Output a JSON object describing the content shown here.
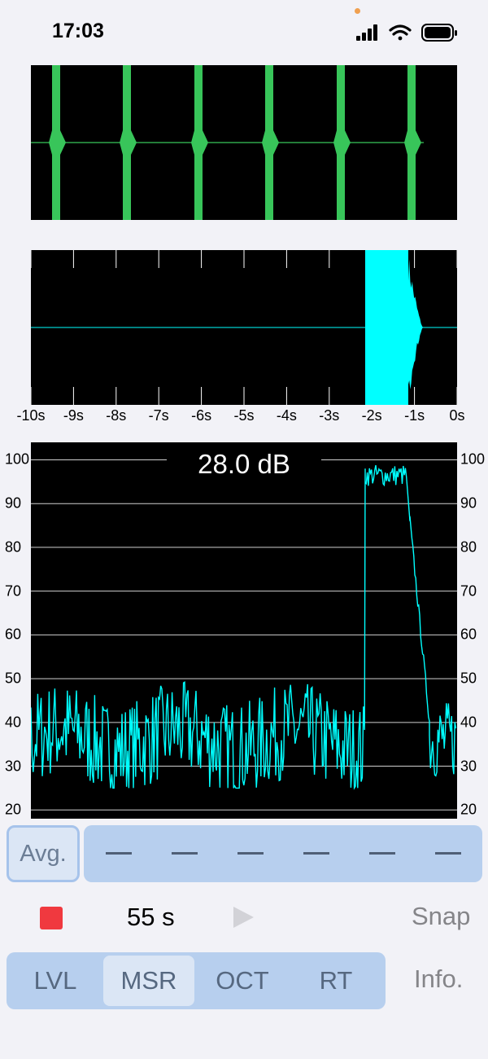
{
  "status_bar": {
    "time": "17:03",
    "icons": [
      "cellular-signal-icon",
      "wifi-icon",
      "battery-icon"
    ]
  },
  "colors": {
    "waveform": "#38c55a",
    "trace": "#00ffff",
    "record": "#f0393f",
    "tab_bar": "#b7cfee",
    "tab_active": "#dbe6f5"
  },
  "time_axis": {
    "labels": [
      "-10s",
      "-9s",
      "-8s",
      "-7s",
      "-6s",
      "-5s",
      "-4s",
      "-3s",
      "-2s",
      "-1s",
      "0s"
    ]
  },
  "level_graph": {
    "readout": "28.0 dB",
    "y_labels": [
      "100",
      "90",
      "80",
      "70",
      "60",
      "50",
      "40",
      "30",
      "20"
    ]
  },
  "chart_data": [
    {
      "type": "line",
      "series": [
        {
          "x": [
            -10,
            -2,
            -1.9,
            -1.2,
            -1.0,
            -0.5,
            0
          ],
          "y": [
            36,
            38,
            98,
            97,
            80,
            40,
            38
          ]
        }
      ],
      "xlabel": "",
      "ylabel": "",
      "ylim": [
        18,
        104
      ],
      "xlim": [
        -10,
        0
      ]
    }
  ],
  "avg": {
    "label": "Avg.",
    "slots": [
      "—",
      "—",
      "—",
      "—",
      "—",
      "—"
    ]
  },
  "controls": {
    "elapsed": "55 s",
    "snap_label": "Snap"
  },
  "tabs": [
    {
      "label": "LVL",
      "active": false
    },
    {
      "label": "MSR",
      "active": true
    },
    {
      "label": "OCT",
      "active": false
    },
    {
      "label": "RT",
      "active": false
    }
  ],
  "info_label": "Info."
}
